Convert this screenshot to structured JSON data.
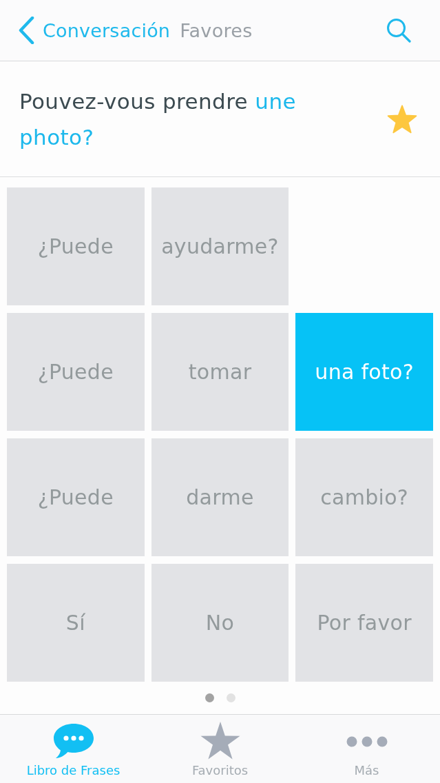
{
  "header": {
    "back_label": "Conversación",
    "title": "Favores"
  },
  "phrase": {
    "segments": [
      {
        "text": "Pouvez-vous prendre",
        "highlighted": false
      },
      {
        "text": "une photo?",
        "highlighted": true
      }
    ],
    "favorite": true
  },
  "grid": {
    "rows": [
      [
        {
          "label": "¿Puede",
          "selected": false
        },
        {
          "label": "ayudarme?",
          "selected": false
        }
      ],
      [
        {
          "label": "¿Puede",
          "selected": false
        },
        {
          "label": "tomar",
          "selected": false
        },
        {
          "label": "una foto?",
          "selected": true
        }
      ],
      [
        {
          "label": "¿Puede",
          "selected": false
        },
        {
          "label": "darme",
          "selected": false
        },
        {
          "label": "cambio?",
          "selected": false
        }
      ],
      [
        {
          "label": "Sí",
          "selected": false
        },
        {
          "label": "No",
          "selected": false
        },
        {
          "label": "Por favor",
          "selected": false
        }
      ]
    ]
  },
  "pager": [
    {
      "selected": true
    },
    {
      "selected": false
    }
  ],
  "tabs": [
    {
      "label": "Libro de Frases",
      "selected": true
    },
    {
      "label": "Favoritos",
      "selected": false
    },
    {
      "label": "Más",
      "selected": false
    }
  ]
}
